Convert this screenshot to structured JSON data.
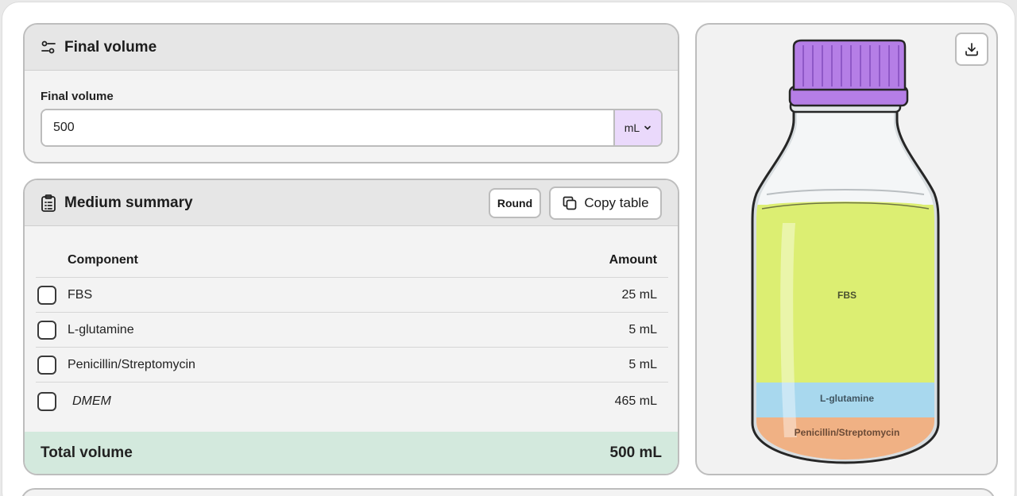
{
  "final_volume_card": {
    "title": "Final volume",
    "field_label": "Final volume",
    "value": "500",
    "unit": "mL",
    "icon": "sliders-icon"
  },
  "summary_card": {
    "title": "Medium summary",
    "icon": "clipboard-list-icon",
    "round_label": "Round",
    "copy_label": "Copy table",
    "columns": {
      "component": "Component",
      "amount": "Amount"
    },
    "rows": [
      {
        "component": "FBS",
        "amount": "25 mL"
      },
      {
        "component": "L-glutamine",
        "amount": "5 mL"
      },
      {
        "component": "Penicillin/Streptomycin",
        "amount": "5 mL"
      },
      {
        "component": "DMEM",
        "amount": "465 mL"
      }
    ],
    "total_label": "Total volume",
    "total_value": "500 mL"
  },
  "bottle": {
    "layers": [
      {
        "label": "FBS",
        "color": "#dcee72"
      },
      {
        "label": "L-glutamine",
        "color": "#a8d8ee"
      },
      {
        "label": "Penicillin/Streptomycin",
        "color": "#f0b184"
      }
    ],
    "cap_color": "#b57ee6",
    "download_icon": "download-icon"
  },
  "colors": {
    "unit_accent": "#ead9fb",
    "total_row": "#d3e9dd"
  }
}
